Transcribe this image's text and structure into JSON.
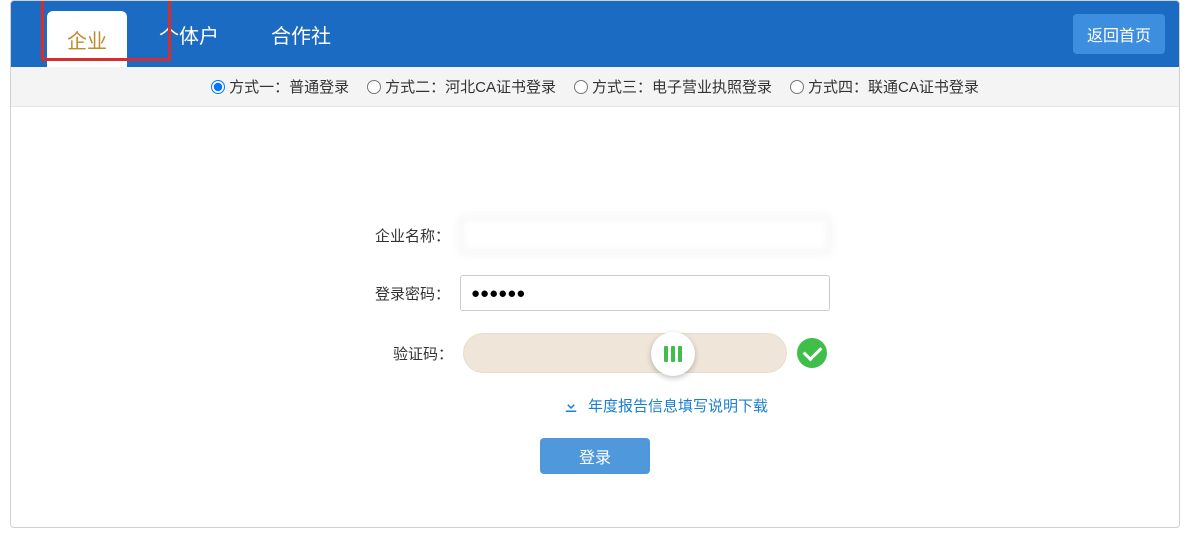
{
  "header": {
    "tabs": [
      "企业",
      "个体户",
      "合作社"
    ],
    "active_tab_index": 0,
    "home_button": "返回首页"
  },
  "subnav": {
    "options": [
      "方式一：普通登录",
      "方式二：河北CA证书登录",
      "方式三：电子营业执照登录",
      "方式四：联通CA证书登录"
    ],
    "selected_index": 0
  },
  "form": {
    "company_name_label": "企业名称：",
    "company_name_value": "",
    "password_label": "登录密码：",
    "password_value": "●●●●●●",
    "captcha_label": "验证码：",
    "download_link": "年度报告信息填写说明下载",
    "login_button": "登录"
  }
}
